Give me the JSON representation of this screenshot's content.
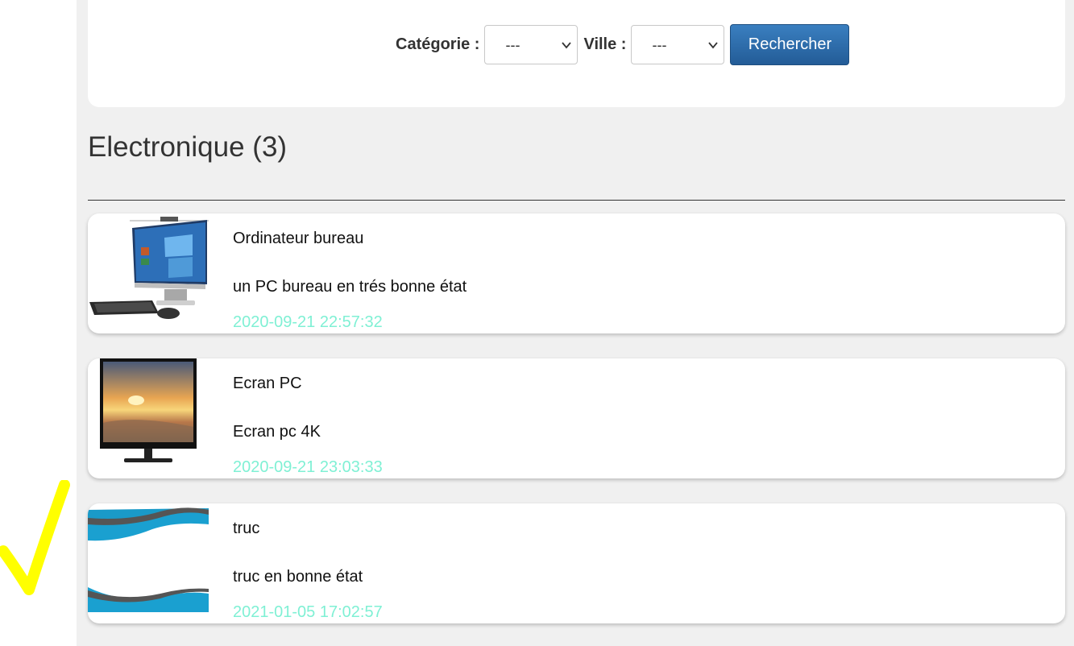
{
  "search": {
    "category_label": "Catégorie :",
    "category_value": "---",
    "city_label": "Ville :",
    "city_value": "---",
    "submit_label": "Rechercher"
  },
  "category": {
    "heading": "Electronique (3)"
  },
  "listings": [
    {
      "title": "Ordinateur bureau",
      "description": "un PC bureau en trés bonne état",
      "date": "2020-09-21 22:57:32",
      "image": "desktop-computer-image"
    },
    {
      "title": "Ecran PC",
      "description": "Ecran pc 4K",
      "date": "2020-09-21 23:03:33",
      "image": "monitor-image"
    },
    {
      "title": "truc",
      "description": "truc en bonne état",
      "date": "2021-01-05 17:02:57",
      "image": "blue-wave-banner-image"
    }
  ],
  "colors": {
    "page_bg": "#f0f0f0",
    "card_bg": "#ffffff",
    "button_blue": "#2a6aa8",
    "date_color": "#7ff0d4",
    "checkmark_yellow": "#ffff00"
  }
}
